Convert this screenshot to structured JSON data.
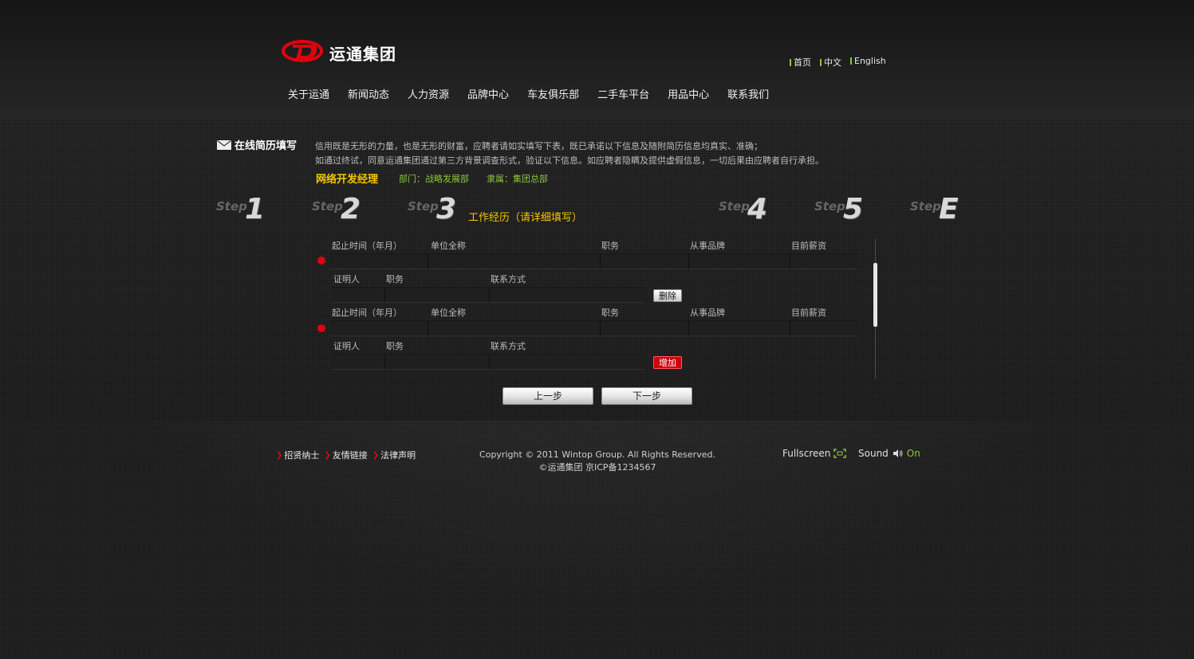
{
  "header": {
    "brand_name": "运通集团",
    "lang_links": [
      "首页",
      "中文",
      "English"
    ],
    "nav": [
      "关于运通",
      "新闻动态",
      "人力资源",
      "品牌中心",
      "车友俱乐部",
      "二手车平台",
      "用品中心",
      "联系我们"
    ]
  },
  "form": {
    "title": "在线简历填写",
    "notice_line1": "信用既是无形的力量，也是无形的财富，应聘者请如实填写下表，既已承诺以下信息及随附简历信息均真实、准确；",
    "notice_line2": "如通过终试，同意运通集团通过第三方背景调查形式，验证以下信息。如应聘者隐瞒及提供虚假信息，一切后果由应聘者自行承担。",
    "job_title": "网络开发经理",
    "department": "部门：战略发展部",
    "belongs_to": "隶属：集团总部"
  },
  "steps": {
    "word": "Step",
    "numbers": [
      "1",
      "2",
      "3",
      "4",
      "5",
      "E"
    ],
    "current_title": "工作经历（请详细填写）"
  },
  "work_entries": {
    "row1_labels": [
      "起止时间（年月）",
      "单位全称",
      "职务",
      "从事品牌",
      "目前薪资"
    ],
    "row2_labels": [
      "证明人",
      "职务",
      "联系方式"
    ],
    "delete_label": "删除",
    "add_label": "增加"
  },
  "buttons": {
    "prev": "上一步",
    "next": "下一步"
  },
  "footer": {
    "links": [
      "招贤纳士",
      "友情链接",
      "法律声明"
    ],
    "copyright": "Copyright © 2011 Wintop Group. All Rights Reserved.",
    "icp": "©运通集团  京ICP备1234567",
    "fullscreen": "Fullscreen",
    "sound": "Sound",
    "sound_state": "On"
  },
  "colors": {
    "accent_red": "#e1000f",
    "accent_green": "#8cc63f",
    "accent_yellow": "#f5c600"
  }
}
